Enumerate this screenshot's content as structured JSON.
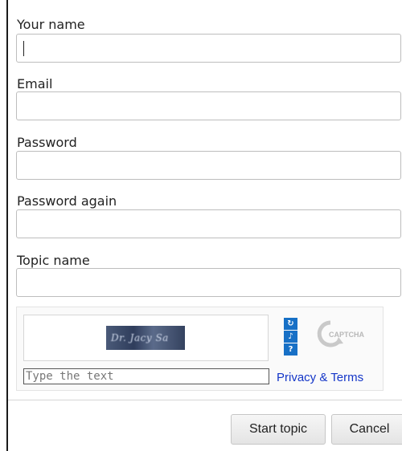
{
  "form": {
    "fields": [
      {
        "label": "Your name",
        "value": "",
        "placeholder": ""
      },
      {
        "label": "Email",
        "value": "",
        "placeholder": ""
      },
      {
        "label": "Password",
        "value": "",
        "placeholder": ""
      },
      {
        "label": "Password again",
        "value": "",
        "placeholder": ""
      },
      {
        "label": "Topic name",
        "value": "",
        "placeholder": ""
      }
    ]
  },
  "captcha": {
    "image_text": "Dr. Jacy Sa",
    "input_placeholder": "Type the text",
    "privacy_link": "Privacy & Terms",
    "logo_text": "CAPTCHA",
    "controls": [
      "refresh-icon",
      "audio-icon",
      "help-icon"
    ]
  },
  "buttons": {
    "start": "Start topic",
    "cancel": "Cancel"
  },
  "colors": {
    "captcha_control": "#1770c6",
    "link": "#1436c8"
  }
}
